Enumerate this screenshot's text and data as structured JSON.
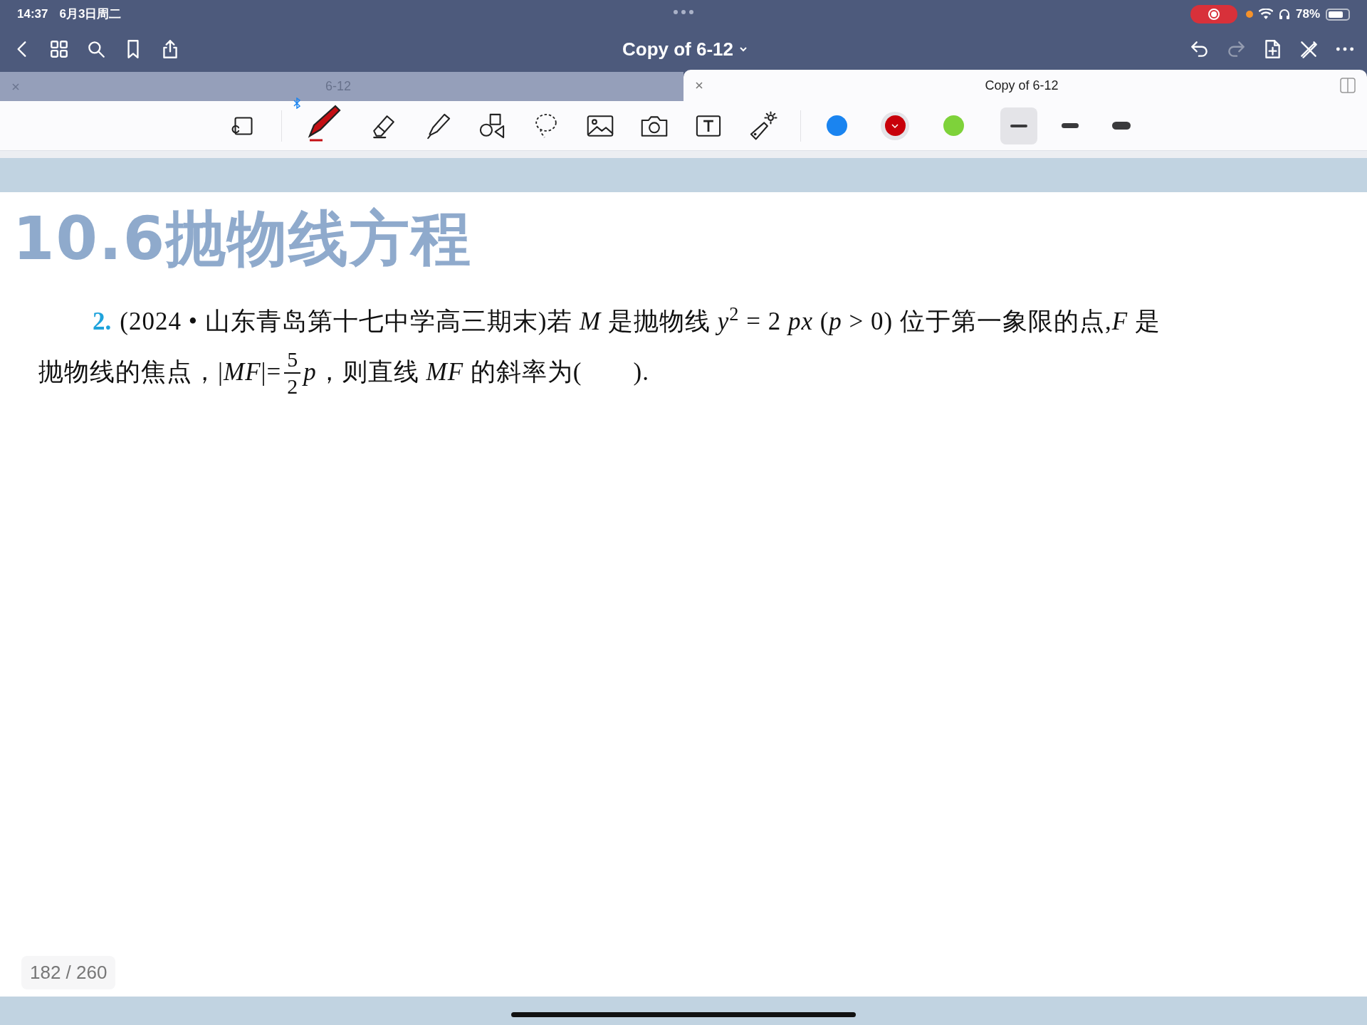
{
  "status_bar": {
    "time": "14:37",
    "date": "6月3日周二",
    "battery": "78%"
  },
  "nav_bar": {
    "title": "Copy of 6-12",
    "left_buttons": [
      {
        "kind": "back"
      },
      {
        "kind": "grid"
      },
      {
        "kind": "search"
      },
      {
        "kind": "bookmark"
      },
      {
        "kind": "share"
      }
    ],
    "right_buttons": [
      {
        "kind": "undo",
        "disabled": false
      },
      {
        "kind": "redo",
        "disabled": true
      },
      {
        "kind": "add-page",
        "disabled": false
      },
      {
        "kind": "pen-off",
        "disabled": false
      },
      {
        "kind": "more",
        "disabled": false
      }
    ]
  },
  "tabs": [
    {
      "label": "6-12",
      "selected": false
    },
    {
      "label": "Copy of 6-12",
      "selected": true
    }
  ],
  "toolbar": {
    "tools": [
      {
        "kind": "zoom-box",
        "selected": false
      },
      {
        "kind": "pen",
        "selected": true
      },
      {
        "kind": "eraser",
        "selected": false
      },
      {
        "kind": "highlighter",
        "selected": false
      },
      {
        "kind": "shapes",
        "selected": false
      },
      {
        "kind": "lasso",
        "selected": false
      },
      {
        "kind": "image",
        "selected": false
      },
      {
        "kind": "camera",
        "selected": false
      },
      {
        "kind": "text",
        "selected": false
      },
      {
        "kind": "laser",
        "selected": false
      }
    ],
    "colors": [
      {
        "color": "#1a84f0",
        "selected": false
      },
      {
        "color": "#c8000a",
        "selected": true
      },
      {
        "color": "#7ed23a",
        "selected": false
      }
    ],
    "strokes": [
      {
        "kind": "thin",
        "selected": true
      },
      {
        "kind": "medium",
        "selected": false
      },
      {
        "kind": "thick",
        "selected": false
      }
    ]
  },
  "page": {
    "title": "10.6抛物线方程",
    "question": {
      "number": "2.",
      "line_1": "(2024 • 山东青岛第十七中学高三期末)若 *M* 是抛物线 *y*$^{2}$ = 2 *px* (*p* > 0) 位于第一象限的点,*F* 是",
      "line_2_before": "抛物线的焦点，|*MF*|=",
      "numerator": "5",
      "denominator": "2",
      "line_2_after": "*p*，则直线 *MF* 的斜率为(　　)."
    },
    "page_counter": "182 / 260"
  }
}
